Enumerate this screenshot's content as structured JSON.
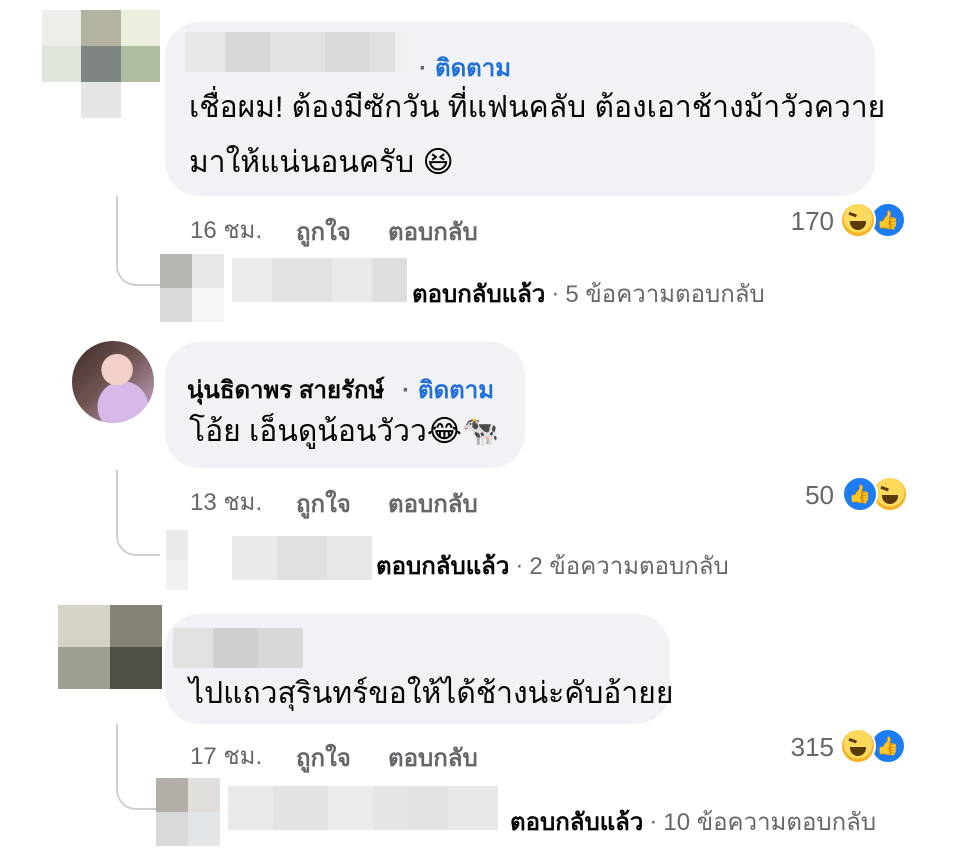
{
  "follow_label": "ติดตาม",
  "like_label": "ถูกใจ",
  "reply_label": "ตอบกลับ",
  "replied_label": "ตอบกลับแล้ว",
  "comments": [
    {
      "text_line1": "เชื่อผม! ต้องมีซักวัน ที่แฟนคลับ ต้องเอาช้างม้าวัวควาย",
      "text_line2": "มาให้แน่นอนครับ 😆",
      "time": "16 ชม.",
      "reaction_count": "170",
      "reactions": [
        "haha-icon",
        "like-icon"
      ],
      "replies_summary": "5 ข้อความตอบกลับ"
    },
    {
      "author": "นุ่นธิดาพร สายรักษ์",
      "text": "โอ้ย เอ็นดูน้อนวัวว😂🐄",
      "time": "13 ชม.",
      "reaction_count": "50",
      "reactions": [
        "like-icon",
        "haha-icon"
      ],
      "replies_summary": "2 ข้อความตอบกลับ"
    },
    {
      "text": "ไปแถวสุรินทร์ขอให้ได้ช้างน่ะคับอ้ายย",
      "time": "17 ชม.",
      "reaction_count": "315",
      "reactions": [
        "haha-icon",
        "like-icon"
      ],
      "replies_summary": "10 ข้อความตอบกลับ"
    }
  ],
  "colors": {
    "bubble": "#f0f2f5",
    "follow": "#216fdb",
    "meta": "#65676b",
    "like": "#1d7cf2",
    "haha": "#f7b125"
  }
}
